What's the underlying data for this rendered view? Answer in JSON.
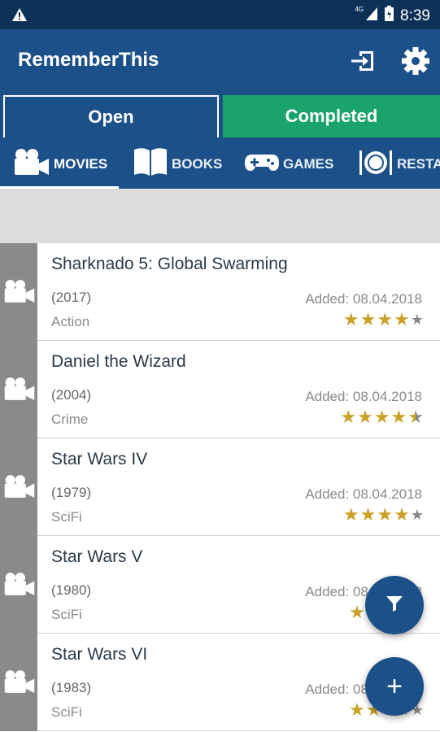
{
  "status_bar": {
    "warning_icon": "warning-icon",
    "network_label": "4G",
    "time": "8:39"
  },
  "app_bar": {
    "title": "RememberThis",
    "login_icon": "login-icon",
    "settings_icon": "gear-icon"
  },
  "segments": {
    "open": "Open",
    "completed": "Completed",
    "active": "open",
    "open_color": "#1b5088",
    "completed_color": "#1aa36a"
  },
  "categories": [
    {
      "label": "MOVIES",
      "icon": "movie-camera-icon"
    },
    {
      "label": "BOOKS",
      "icon": "book-icon"
    },
    {
      "label": "GAMES",
      "icon": "gamepad-icon"
    },
    {
      "label": "RESTA",
      "icon": "restaurant-icon"
    }
  ],
  "items": [
    {
      "title": "Sharknado 5: Global Swarming",
      "year": "(2017)",
      "genre": "Action",
      "added": "Added: 08.04.2018",
      "rating": 4
    },
    {
      "title": "Daniel the Wizard",
      "year": "(2004)",
      "genre": "Crime",
      "added": "Added: 08.04.2018",
      "rating": 4.5
    },
    {
      "title": "Star Wars IV",
      "year": "(1979)",
      "genre": "SciFi",
      "added": "Added: 08.04.2018",
      "rating": 4
    },
    {
      "title": "Star Wars V",
      "year": "(1980)",
      "genre": "SciFi",
      "added": "Added: 08.04.2018",
      "rating": 2
    },
    {
      "title": "Star Wars VI",
      "year": "(1983)",
      "genre": "SciFi",
      "added": "Added: 08.04.2018",
      "rating": 2
    }
  ],
  "fabs": {
    "filter_icon": "filter-icon",
    "add_label": "+"
  },
  "colors": {
    "primary": "#1b5088",
    "status_bar": "#0d3057",
    "star_filled": "#c9a227",
    "star_empty": "#888888"
  }
}
